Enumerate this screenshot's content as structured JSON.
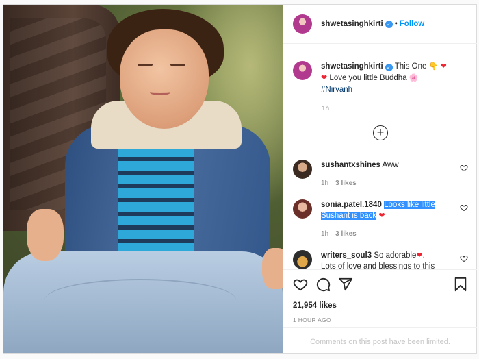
{
  "header": {
    "username": "shwetasinghkirti",
    "separator": "•",
    "follow_label": "Follow"
  },
  "caption": {
    "username": "shwetasinghkirti",
    "text_part1": "This One",
    "emoji_point": "👇",
    "emoji_heart": "❤",
    "text_part2": "Love you little Buddha",
    "emoji_flower": "🌸",
    "hashtag": "#Nirvanh",
    "time": "1h"
  },
  "load_more_symbol": "+",
  "comments": [
    {
      "username": "sushantxshines",
      "text": "Aww",
      "time": "1h",
      "likes": "3 likes"
    },
    {
      "username": "sonia.patel.1840",
      "text": "Looks like little Sushant is back",
      "emoji": "❤",
      "time": "1h",
      "likes": "3 likes"
    },
    {
      "username": "writers_soul3",
      "text": "So adorable",
      "emoji": "❤",
      "text_tail": ".",
      "text_line2": "Lots of love and blessings to this"
    }
  ],
  "actions": {
    "icons": [
      "heart-icon",
      "comment-icon",
      "share-icon",
      "bookmark-icon"
    ],
    "likes": "21,954 likes",
    "posted": "1 HOUR AGO",
    "comments_limited": "Comments on this post have been limited."
  },
  "colors": {
    "accent": "#0095f6",
    "verified": "#3897f0",
    "heart": "#ed2633",
    "selection": "#3390ff"
  }
}
